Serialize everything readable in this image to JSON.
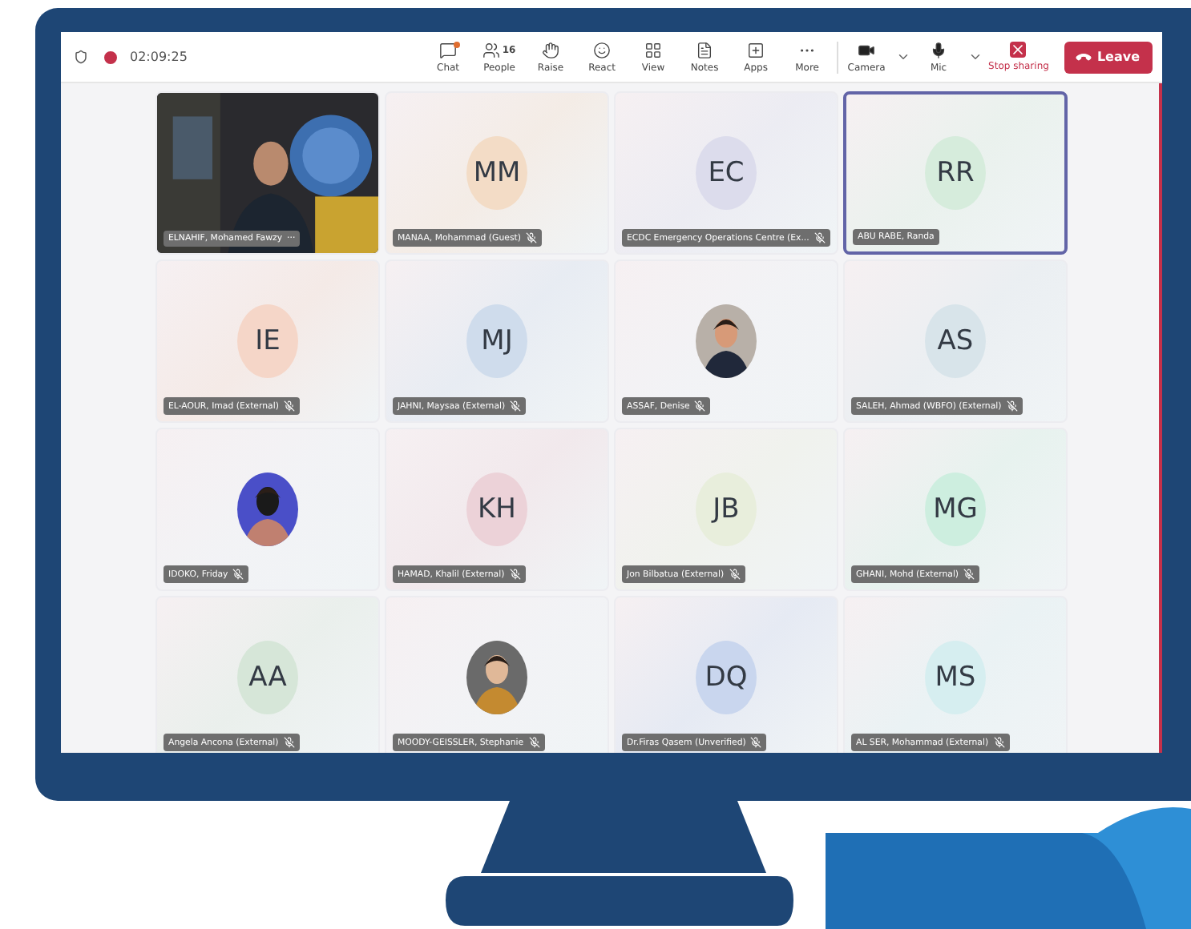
{
  "toolbar": {
    "timer": "02:09:25",
    "recording": true,
    "items": [
      {
        "kind": "chat",
        "label": "Chat",
        "badge": true
      },
      {
        "kind": "people",
        "label": "People",
        "count": "16"
      },
      {
        "kind": "raise",
        "label": "Raise"
      },
      {
        "kind": "react",
        "label": "React"
      },
      {
        "kind": "view",
        "label": "View"
      },
      {
        "kind": "notes",
        "label": "Notes"
      },
      {
        "kind": "apps",
        "label": "Apps"
      },
      {
        "kind": "more",
        "label": "More"
      },
      {
        "kind": "camera",
        "label": "Camera",
        "menu": true
      },
      {
        "kind": "mic",
        "label": "Mic",
        "menu": true
      },
      {
        "kind": "stop",
        "label": "Stop sharing"
      }
    ],
    "leave": "Leave"
  },
  "tiles": [
    {
      "kind": "video",
      "name": "ELNAHIF, Mohamed Fawzy",
      "more": "···",
      "muted": false,
      "selected": false
    },
    {
      "kind": "initials",
      "initials": "MM",
      "name": "MANAA, Mohammad (Guest)",
      "color": "#f3dcc6",
      "muted": true,
      "selected": false
    },
    {
      "kind": "initials",
      "initials": "EC",
      "name": "ECDC Emergency Operations Centre (Ex...",
      "color": "#dcdcec",
      "muted": true,
      "selected": false
    },
    {
      "kind": "initials",
      "initials": "RR",
      "name": "ABU RABE, Randa",
      "color": "#d6ecdc",
      "muted": false,
      "selected": true
    },
    {
      "kind": "initials",
      "initials": "IE",
      "name": "EL-AOUR, Imad (External)",
      "color": "#f5d6c8",
      "muted": true,
      "selected": false
    },
    {
      "kind": "initials",
      "initials": "MJ",
      "name": "JAHNI, Maysaa (External)",
      "color": "#cfdcec",
      "muted": true,
      "selected": false
    },
    {
      "name": "ASSAF, Denise",
      "muted": true,
      "selected": false
    },
    {
      "kind": "initials",
      "initials": "AS",
      "name": "SALEH, Ahmad (WBFO) (External)",
      "color": "#d8e4ea",
      "muted": true,
      "selected": false
    },
    {
      "name": "IDOKO, Friday",
      "muted": true,
      "selected": false
    },
    {
      "kind": "initials",
      "initials": "KH",
      "name": "HAMAD, Khalil (External)",
      "color": "#ecd2d8",
      "muted": true,
      "selected": false
    },
    {
      "kind": "initials",
      "initials": "JB",
      "name": "Jon Bilbatua (External)",
      "color": "#e8eedc",
      "muted": true,
      "selected": false
    },
    {
      "kind": "initials",
      "initials": "MG",
      "name": "GHANI, Mohd (External)",
      "color": "#cdeedf",
      "muted": true,
      "selected": false
    },
    {
      "kind": "initials",
      "initials": "AA",
      "name": "Angela Ancona (External)",
      "color": "#d6e6d8",
      "muted": true,
      "selected": false
    },
    {
      "name": "MOODY-GEISSLER, Stephanie",
      "muted": true,
      "selected": false
    },
    {
      "kind": "initials",
      "initials": "DQ",
      "name": "Dr.Firas Qasem (Unverified)",
      "color": "#c9d6ee",
      "muted": true,
      "selected": false
    },
    {
      "kind": "initials",
      "initials": "MS",
      "name": "AL SER, Mohammad (External)",
      "color": "#d6eef0",
      "muted": true,
      "selected": false
    }
  ]
}
